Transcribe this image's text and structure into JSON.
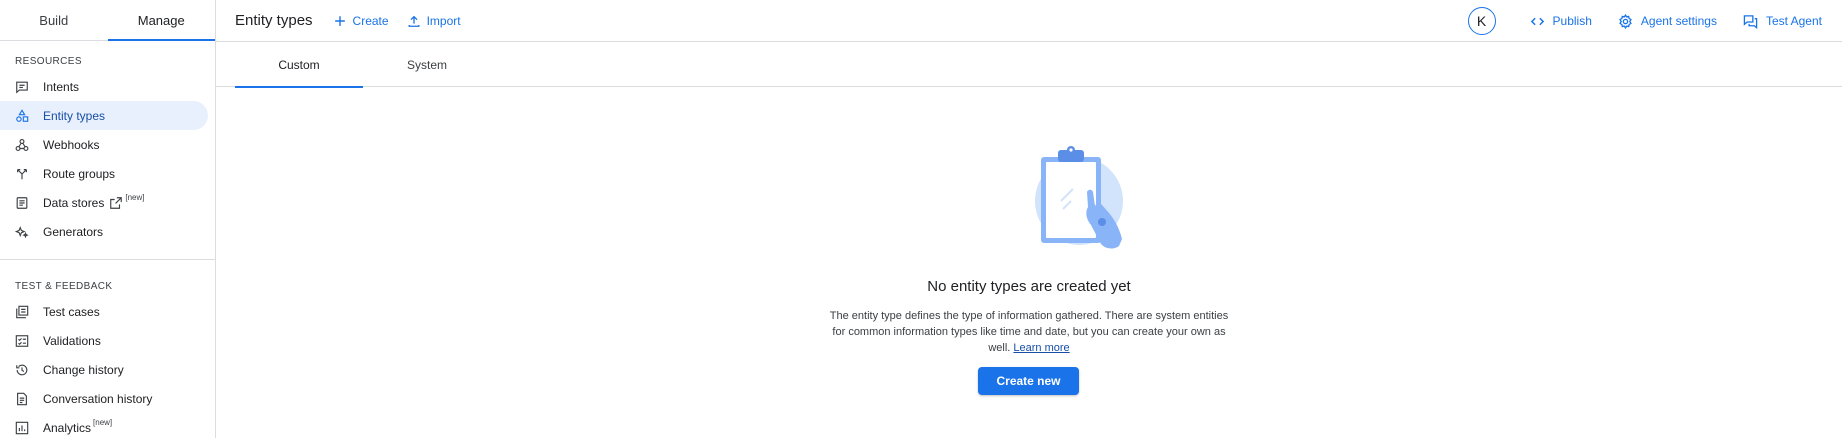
{
  "sidebar": {
    "tabs": [
      {
        "label": "Build"
      },
      {
        "label": "Manage"
      }
    ],
    "resources_title": "RESOURCES",
    "resources": [
      {
        "label": "Intents"
      },
      {
        "label": "Entity types"
      },
      {
        "label": "Webhooks"
      },
      {
        "label": "Route groups"
      },
      {
        "label": "Data stores",
        "badge": "[new]"
      },
      {
        "label": "Generators"
      }
    ],
    "test_title": "TEST & FEEDBACK",
    "test": [
      {
        "label": "Test cases"
      },
      {
        "label": "Validations"
      },
      {
        "label": "Change history"
      },
      {
        "label": "Conversation history"
      },
      {
        "label": "Analytics",
        "badge": "[new]"
      }
    ]
  },
  "header": {
    "title": "Entity types",
    "create_label": "Create",
    "import_label": "Import",
    "avatar_initial": "K",
    "publish_label": "Publish",
    "agent_settings_label": "Agent settings",
    "test_agent_label": "Test Agent"
  },
  "content_tabs": [
    {
      "label": "Custom"
    },
    {
      "label": "System"
    }
  ],
  "empty_state": {
    "title": "No entity types are created yet",
    "description": "The entity type defines the type of information gathered. There are system entities for common information types like time and date, but you can create your own as well.",
    "learn_more": "Learn more",
    "button_label": "Create new"
  },
  "colors": {
    "accent": "#1a73e8",
    "selected_bg": "#e8f0fe",
    "border": "#dadce0"
  }
}
